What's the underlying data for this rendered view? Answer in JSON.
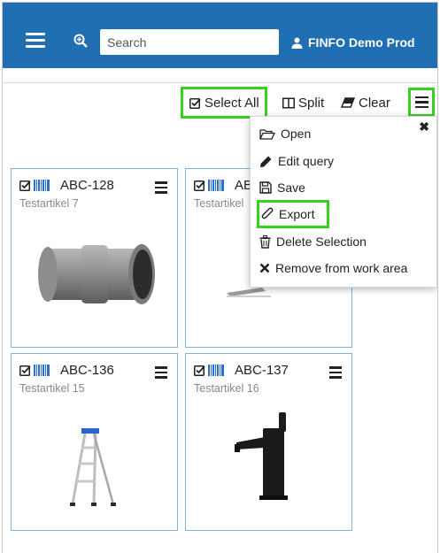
{
  "header": {
    "search_placeholder": "Search",
    "user_label": "FINFO Demo Prod",
    "bar_color": "#1f6fb2"
  },
  "toolbar": {
    "select_all": "Select All",
    "split": "Split",
    "clear": "Clear"
  },
  "menu": {
    "items": [
      {
        "icon": "folder-open-icon",
        "label": "Open"
      },
      {
        "icon": "pencil-icon",
        "label": "Edit query"
      },
      {
        "icon": "save-icon",
        "label": "Save"
      },
      {
        "icon": "paperclip-icon",
        "label": "Export"
      },
      {
        "icon": "trash-icon",
        "label": "Delete Selection"
      },
      {
        "icon": "x-icon",
        "label": "Remove from work area"
      }
    ]
  },
  "cards": [
    {
      "code": "ABC-128",
      "name": "Testartikel 7",
      "image": "pipe-coupling"
    },
    {
      "code": "AB",
      "name": "Testartikel",
      "image": "faucet-partial"
    },
    {
      "code": "ABC-136",
      "name": "Testartikel 15",
      "image": "step-ladder"
    },
    {
      "code": "ABC-137",
      "name": "Testartikel 16",
      "image": "black-faucet"
    }
  ],
  "highlight_color": "#37d11f"
}
